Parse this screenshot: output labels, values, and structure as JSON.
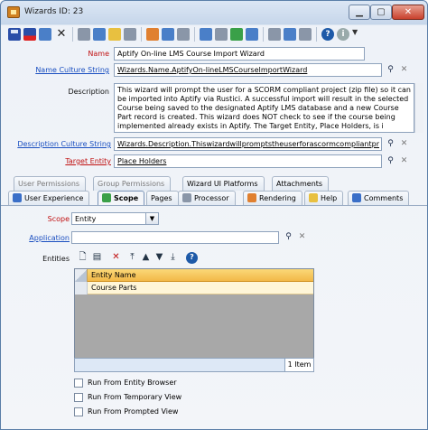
{
  "window": {
    "title": "Wizards ID: 23"
  },
  "form": {
    "name_label": "Name",
    "name_value": "Aptify On-line LMS Course Import Wizard",
    "name_culture_label": "Name Culture String",
    "name_culture_value": "Wizards.Name.AptifyOn-lineLMSCourseImportWizard",
    "description_label": "Description",
    "description_value": "This wizard will prompt the user for a SCORM compliant project (zip file) so it can be imported into Aptify via Rustici. A successful import will result in the selected Course being saved to the designated Aptify LMS database and a new Course Part record is created. This wizard does NOT check to see if the course being implemented already exists in Aptify. The Target Entity, Place Holders, is i",
    "description_culture_label": "Description Culture String",
    "description_culture_value": "Wizards.Description.Thiswizardwillpromptstheuserforascormcompliantpr",
    "target_entity_label": "Target Entity",
    "target_entity_value": "Place Holders"
  },
  "tabs_row1": [
    "User Permissions",
    "Group Permissions",
    "Wizard UI Platforms",
    "Attachments"
  ],
  "tabs_row2": [
    "User Experience",
    "Scope",
    "Pages",
    "Processor",
    "Rendering",
    "Help",
    "Comments"
  ],
  "scope": {
    "scope_label": "Scope",
    "scope_value": "Entity",
    "application_label": "Application",
    "entities_label": "Entities",
    "grid_header": "Entity Name",
    "rows": [
      "Course Parts"
    ],
    "count": "1 Item",
    "checkboxes": [
      "Run From Entity Browser",
      "Run From Temporary View",
      "Run From Prompted View"
    ]
  }
}
